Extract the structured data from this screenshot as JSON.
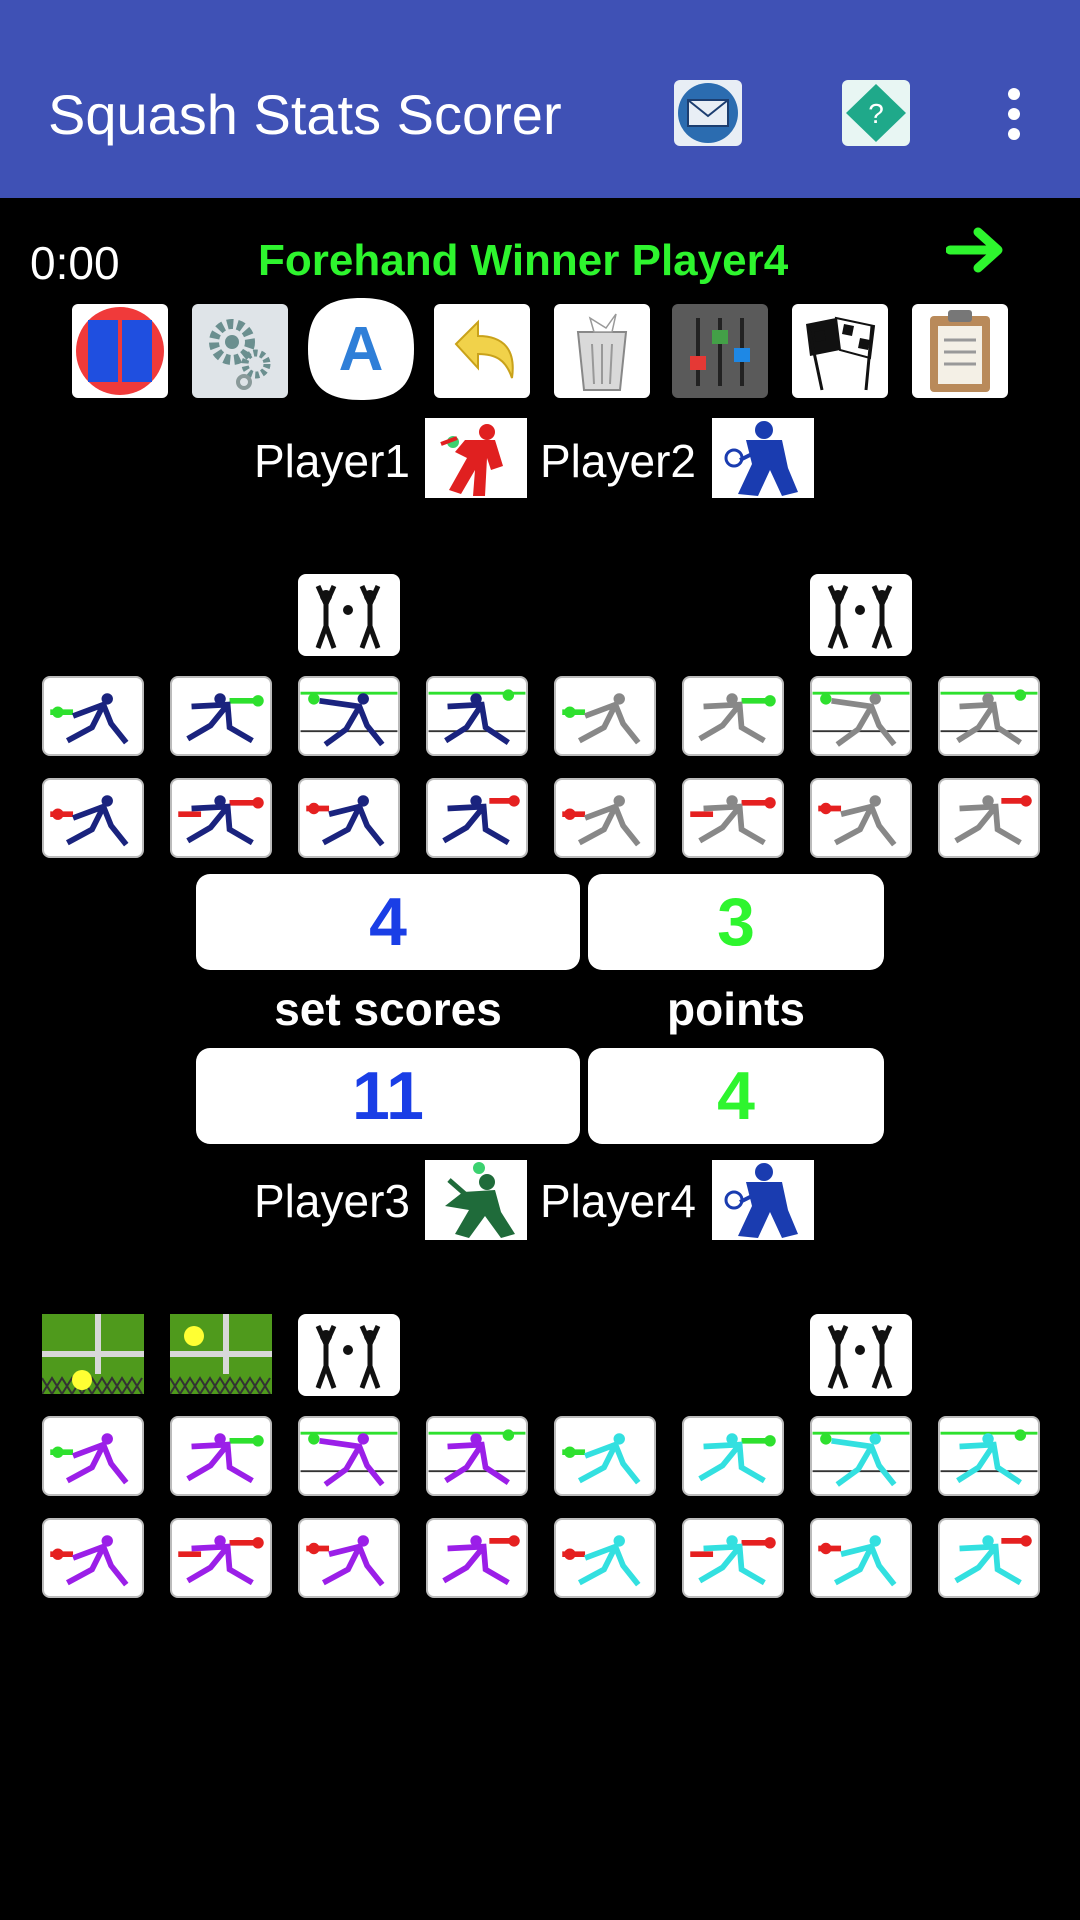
{
  "app": {
    "title": "Squash Stats Scorer",
    "icons": [
      "mail-icon",
      "help-icon",
      "more-options-icon"
    ]
  },
  "status": {
    "timer": "0:00",
    "message": "Forehand Winner Player4",
    "message_color": "#2ef52e"
  },
  "toolbar": [
    "doubles-icon",
    "settings-icon",
    "auto-icon",
    "undo-icon",
    "trash-icon",
    "mixer-icon",
    "finish-flag-icon",
    "clipboard-icon"
  ],
  "team1": {
    "player_a": "Player1",
    "player_b": "Player2",
    "colors": {
      "a": "#1a237e",
      "b": "#888888"
    }
  },
  "team2": {
    "player_a": "Player3",
    "player_b": "Player4",
    "colors": {
      "a": "#9b1fe8",
      "b": "#33e0e0"
    }
  },
  "scores": {
    "top_left": "4",
    "top_right": "3",
    "set_scores_label": "set scores",
    "points_label": "points",
    "bottom_left": "11",
    "bottom_right": "4"
  },
  "colors": {
    "appbar": "#3f51b5",
    "blue_score": "#1a3ee6",
    "green_score": "#2ef52e"
  }
}
